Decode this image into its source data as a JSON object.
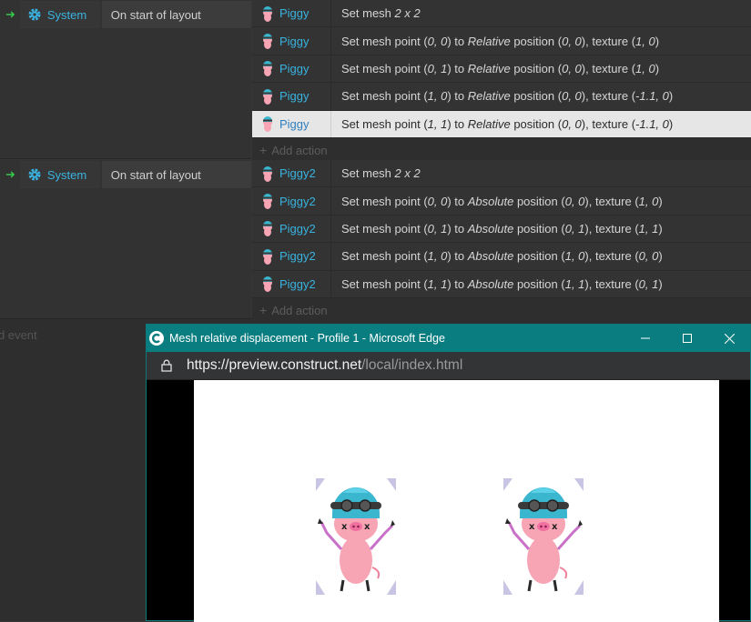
{
  "events": [
    {
      "trigger": {
        "object": "System",
        "condition": "On start of layout"
      },
      "actions": [
        {
          "object": "Piggy",
          "parts": [
            [
              "Set mesh ",
              false
            ],
            [
              "2 x 2",
              true
            ]
          ],
          "selected": false
        },
        {
          "object": "Piggy",
          "parts": [
            [
              "Set mesh point (",
              false
            ],
            [
              "0, 0",
              true
            ],
            [
              ") to ",
              false
            ],
            [
              "Relative",
              true
            ],
            [
              " position (",
              false
            ],
            [
              "0, 0",
              true
            ],
            [
              "), texture (",
              false
            ],
            [
              "1, 0",
              true
            ],
            [
              ")",
              false
            ]
          ],
          "selected": false
        },
        {
          "object": "Piggy",
          "parts": [
            [
              "Set mesh point (",
              false
            ],
            [
              "0, 1",
              true
            ],
            [
              ") to ",
              false
            ],
            [
              "Relative",
              true
            ],
            [
              " position (",
              false
            ],
            [
              "0, 0",
              true
            ],
            [
              "), texture (",
              false
            ],
            [
              "1, 0",
              true
            ],
            [
              ")",
              false
            ]
          ],
          "selected": false
        },
        {
          "object": "Piggy",
          "parts": [
            [
              "Set mesh point (",
              false
            ],
            [
              "1, 0",
              true
            ],
            [
              ") to ",
              false
            ],
            [
              "Relative",
              true
            ],
            [
              " position (",
              false
            ],
            [
              "0, 0",
              true
            ],
            [
              "), texture (",
              false
            ],
            [
              "-1.1, 0",
              true
            ],
            [
              ")",
              false
            ]
          ],
          "selected": false
        },
        {
          "object": "Piggy",
          "parts": [
            [
              "Set mesh point (",
              false
            ],
            [
              "1, 1",
              true
            ],
            [
              ") to ",
              false
            ],
            [
              "Relative",
              true
            ],
            [
              " position (",
              false
            ],
            [
              "0, 0",
              true
            ],
            [
              "), texture (",
              false
            ],
            [
              "-1.1, 0",
              true
            ],
            [
              ")",
              false
            ]
          ],
          "selected": true
        }
      ],
      "add_action": "Add action"
    },
    {
      "trigger": {
        "object": "System",
        "condition": "On start of layout"
      },
      "actions": [
        {
          "object": "Piggy2",
          "parts": [
            [
              "Set mesh ",
              false
            ],
            [
              "2 x 2",
              true
            ]
          ],
          "selected": false
        },
        {
          "object": "Piggy2",
          "parts": [
            [
              "Set mesh point (",
              false
            ],
            [
              "0, 0",
              true
            ],
            [
              ") to ",
              false
            ],
            [
              "Absolute",
              true
            ],
            [
              " position (",
              false
            ],
            [
              "0, 0",
              true
            ],
            [
              "), texture (",
              false
            ],
            [
              "1, 0",
              true
            ],
            [
              ")",
              false
            ]
          ],
          "selected": false
        },
        {
          "object": "Piggy2",
          "parts": [
            [
              "Set mesh point (",
              false
            ],
            [
              "0, 1",
              true
            ],
            [
              ") to ",
              false
            ],
            [
              "Absolute",
              true
            ],
            [
              " position (",
              false
            ],
            [
              "0, 1",
              true
            ],
            [
              "), texture (",
              false
            ],
            [
              "1, 1",
              true
            ],
            [
              ")",
              false
            ]
          ],
          "selected": false
        },
        {
          "object": "Piggy2",
          "parts": [
            [
              "Set mesh point (",
              false
            ],
            [
              "1, 0",
              true
            ],
            [
              ") to ",
              false
            ],
            [
              "Absolute",
              true
            ],
            [
              " position (",
              false
            ],
            [
              "1, 0",
              true
            ],
            [
              "), texture (",
              false
            ],
            [
              "0, 0",
              true
            ],
            [
              ")",
              false
            ]
          ],
          "selected": false
        },
        {
          "object": "Piggy2",
          "parts": [
            [
              "Set mesh point (",
              false
            ],
            [
              "1, 1",
              true
            ],
            [
              ") to ",
              false
            ],
            [
              "Absolute",
              true
            ],
            [
              " position (",
              false
            ],
            [
              "1, 1",
              true
            ],
            [
              "), texture (",
              false
            ],
            [
              "0, 1",
              true
            ],
            [
              ")",
              false
            ]
          ],
          "selected": false
        }
      ],
      "add_action": "Add action"
    }
  ],
  "add_event": "d event",
  "browser": {
    "title": "Mesh relative displacement - Profile 1 - Microsoft Edge",
    "url_main": "https://preview.construct.net",
    "url_path": "/local/index.html",
    "minimize_icon": "minimize-icon",
    "maximize_icon": "maximize-icon",
    "close_icon": "close-icon"
  },
  "colors": {
    "accent": "#3ab3e0",
    "titlebar": "#0a7d80",
    "trigger_arrow": "#36c24a"
  }
}
